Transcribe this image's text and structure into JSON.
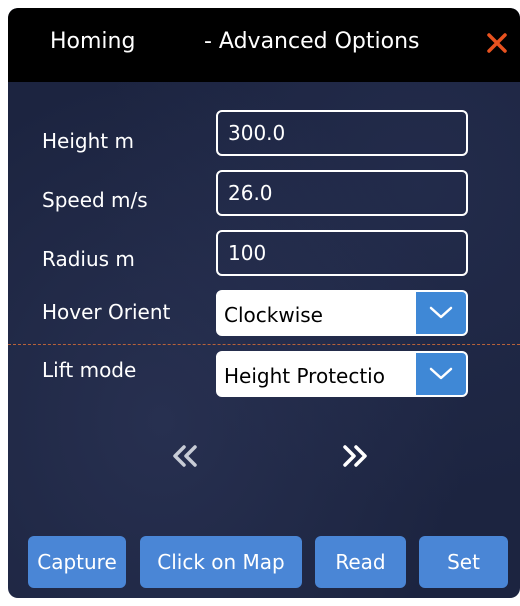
{
  "header": {
    "title": "Homing",
    "subtitle": "- Advanced Options",
    "close_icon": "close-icon",
    "close_color": "#e8521f"
  },
  "form": {
    "height_label": "Height m",
    "height_value": "300.0",
    "speed_label": "Speed m/s",
    "speed_value": "26.0",
    "radius_label": "Radius m",
    "radius_value": "100",
    "hover_orient_label": "Hover Orient",
    "hover_orient_value": "Clockwise",
    "lift_mode_label": "Lift mode",
    "lift_mode_value": "Height Protectio"
  },
  "nav": {
    "prev_icon": "double-chevron-left-icon",
    "next_icon": "double-chevron-right-icon"
  },
  "buttons": {
    "capture": "Capture",
    "click_on_map": "Click on Map",
    "read": "Read",
    "set": "Set"
  },
  "colors": {
    "panel_bg": "#1c2440",
    "titlebar_bg": "#000000",
    "button_bg": "#4a86d6",
    "dropdown_accent": "#3f88d6"
  }
}
